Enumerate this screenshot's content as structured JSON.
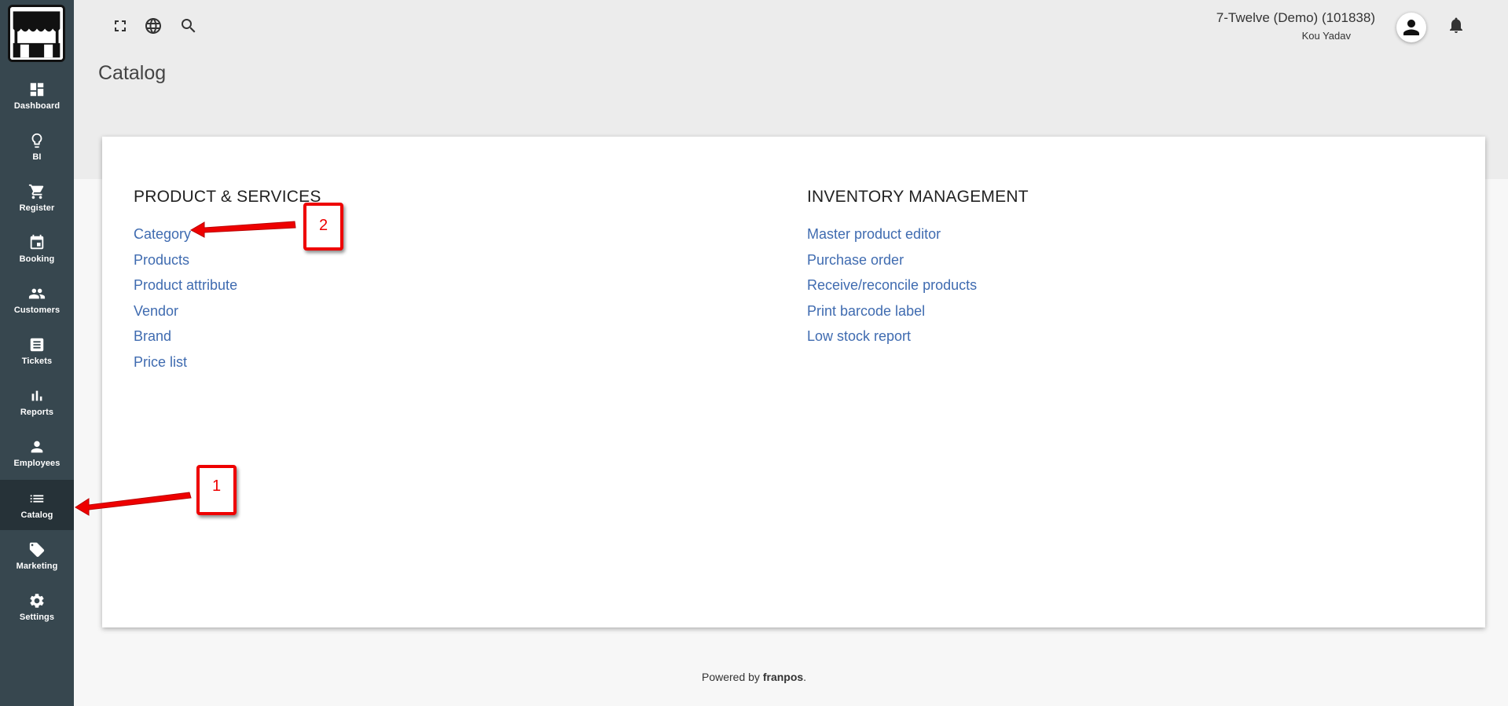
{
  "sidebar": {
    "items": [
      {
        "label": "Dashboard",
        "icon": "dashboard-icon"
      },
      {
        "label": "BI",
        "icon": "lightbulb-icon"
      },
      {
        "label": "Register",
        "icon": "cart-icon"
      },
      {
        "label": "Booking",
        "icon": "calendar-icon"
      },
      {
        "label": "Customers",
        "icon": "people-icon"
      },
      {
        "label": "Tickets",
        "icon": "ticket-icon"
      },
      {
        "label": "Reports",
        "icon": "bar-chart-icon"
      },
      {
        "label": "Employees",
        "icon": "person-icon"
      },
      {
        "label": "Catalog",
        "icon": "list-icon",
        "active": true
      },
      {
        "label": "Marketing",
        "icon": "tag-icon"
      },
      {
        "label": "Settings",
        "icon": "gear-icon"
      }
    ]
  },
  "header": {
    "store_name": "7-Twelve (Demo) (101838)",
    "user_name": "Kou Yadav",
    "icons": [
      "fullscreen-icon",
      "globe-icon",
      "search-icon",
      "avatar-icon",
      "bell-icon"
    ]
  },
  "page": {
    "title": "Catalog"
  },
  "card": {
    "product_services": {
      "title": "PRODUCT & SERVICES",
      "links": [
        "Category",
        "Products",
        "Product attribute",
        "Vendor",
        "Brand",
        "Price list"
      ]
    },
    "inventory": {
      "title": "INVENTORY MANAGEMENT",
      "links": [
        "Master product editor",
        "Purchase order",
        "Receive/reconcile products",
        "Print barcode label",
        "Low stock report"
      ]
    }
  },
  "footer": {
    "prefix": "Powered by",
    "brand": "franpos",
    "suffix": "."
  },
  "annotations": {
    "callout_1": "1",
    "callout_2": "2",
    "color": "#e00000"
  },
  "colors": {
    "sidebar_bg": "#37474f",
    "sidebar_active": "#263238",
    "link": "#3f6bb0",
    "header_bg": "#ececec"
  }
}
